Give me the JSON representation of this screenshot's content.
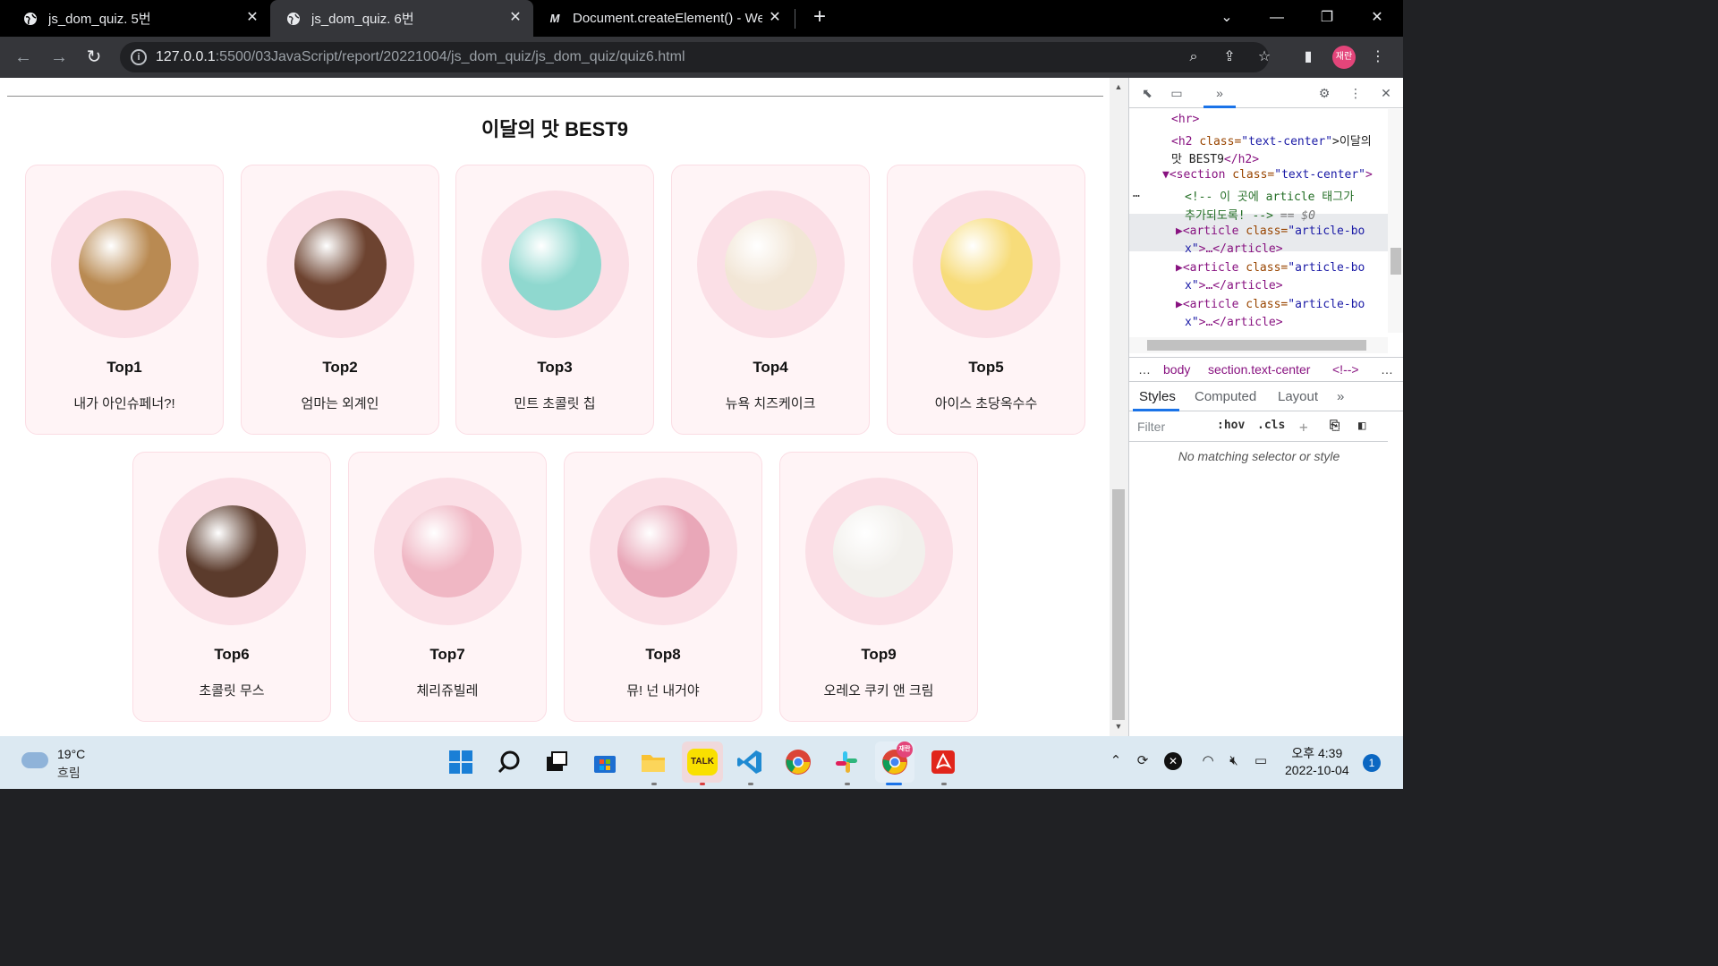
{
  "browser": {
    "tabs": [
      {
        "title": "js_dom_quiz. 5번"
      },
      {
        "title": "js_dom_quiz. 6번"
      },
      {
        "title": "Document.createElement() - We"
      }
    ],
    "url_host": "127.0.0.1",
    "url_rest": ":5500/03JavaScript/report/20221004/js_dom_quiz/js_dom_quiz/quiz6.html",
    "profile_label": "재란"
  },
  "page": {
    "heading": "이달의 맛 BEST9",
    "cards": [
      {
        "name": "Top1",
        "desc": "내가 아인슈페너?!",
        "color": "#b98a52"
      },
      {
        "name": "Top2",
        "desc": "엄마는 외계인",
        "color": "#6d4330"
      },
      {
        "name": "Top3",
        "desc": "민트 초콜릿 칩",
        "color": "#8fd8cf"
      },
      {
        "name": "Top4",
        "desc": "뉴욕 치즈케이크",
        "color": "#f2e6d6"
      },
      {
        "name": "Top5",
        "desc": "아이스 초당옥수수",
        "color": "#f7dc7a"
      },
      {
        "name": "Top6",
        "desc": "초콜릿 무스",
        "color": "#5b3b2c"
      },
      {
        "name": "Top7",
        "desc": "체리쥬빌레",
        "color": "#f0b7c4"
      },
      {
        "name": "Top8",
        "desc": "뮤! 넌 내거야",
        "color": "#e9a7b8"
      },
      {
        "name": "Top9",
        "desc": "오레오 쿠키 앤 크림",
        "color": "#f2f0ec"
      }
    ]
  },
  "devtools": {
    "lines": {
      "hr": "<hr>",
      "h2_open": "<h2",
      "h2_attr": "class=",
      "h2_val": "\"text-center\"",
      "h2_text": ">이달의",
      "h2_text2": "맛 BEST9",
      "h2_close": "</h2>",
      "section_open": "▼<section",
      "section_attr": "class=",
      "section_val": "\"text-center\"",
      "section_close": ">",
      "comment1": "<!-- 이 곳에 article 태그가",
      "comment2": "추가되도록! -->",
      "comment_eq": "== $0",
      "article_open": "▶<article",
      "article_attr": "class=",
      "article_val": "\"article-bo",
      "article_val2": "x\"",
      "article_close": ">…</article>",
      "ellipsis": "…"
    },
    "breadcrumbs": [
      "…",
      "body",
      "section.text-center",
      "<!-->",
      "…"
    ],
    "panel_tabs": [
      "Styles",
      "Computed",
      "Layout",
      "»"
    ],
    "filter_placeholder": "Filter",
    "hov": ":hov",
    "cls": ".cls",
    "no_match": "No matching selector or style"
  },
  "taskbar": {
    "temperature": "19°C",
    "condition": "흐림",
    "time": "오후 4:39",
    "date": "2022-10-04",
    "notifications": "1",
    "kakao_label": "TALK"
  }
}
